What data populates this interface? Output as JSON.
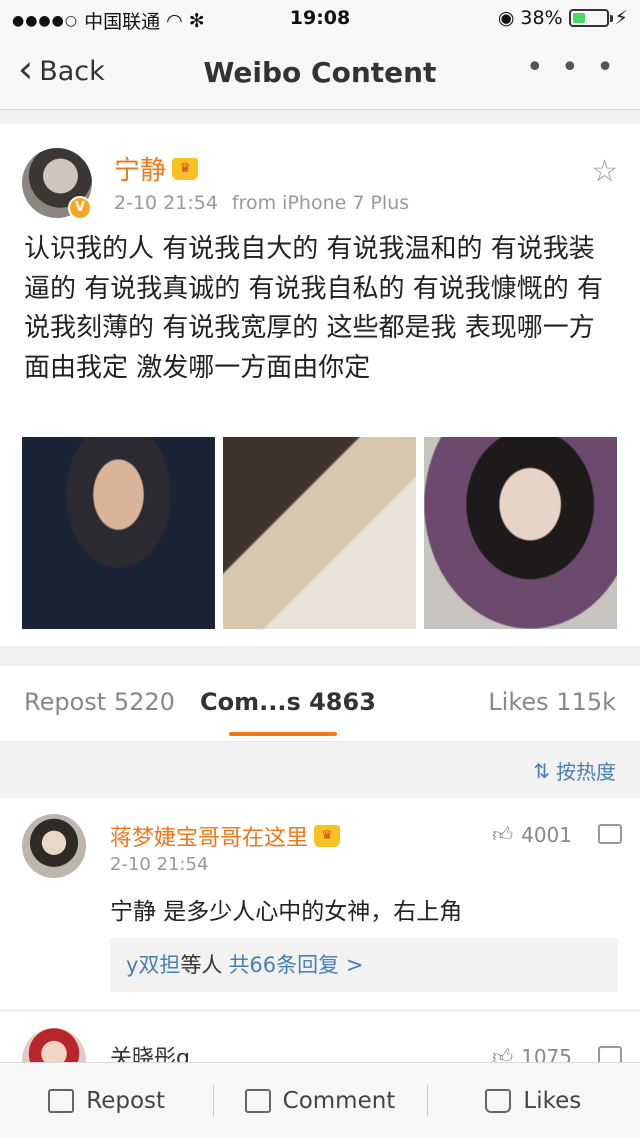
{
  "status_bar": {
    "carrier": "中国联通",
    "time": "19:08",
    "battery": "38%",
    "battery_level": 0.38
  },
  "nav": {
    "back_label": "Back",
    "title": "Weibo Content",
    "more_label": "• • •"
  },
  "post": {
    "author": "宁静",
    "verified_badge": "V",
    "time": "2-10 21:54",
    "source": "from iPhone 7 Plus",
    "text": "认识我的人  有说我自大的  有说我温和的  有说我装逼的  有说我真诚的  有说我自私的  有说我慷慨的  有说我刻薄的  有说我宽厚的  这些都是我  表现哪一方面由我定  激发哪一方面由你定",
    "photos": [
      "photo-1",
      "photo-2",
      "photo-3"
    ]
  },
  "tabs": {
    "repost": "Repost 5220",
    "comments": "Com...s 4863",
    "likes": "Likes 115k",
    "active": "comments"
  },
  "sort": {
    "label": "按热度"
  },
  "comments": [
    {
      "name": "蒋梦婕宝哥哥在这里",
      "time": "2-10 21:54",
      "text": "宁静 是多少人心中的女神，右上角",
      "likes": "4001",
      "replies_who": "y双担",
      "replies_mid": "等人",
      "replies_total": "共66条回复 >"
    },
    {
      "name": "关晓彤g",
      "likes": "1075"
    }
  ],
  "toolbar": {
    "repost": "Repost",
    "comment": "Comment",
    "likes": "Likes"
  },
  "colors": {
    "accent": "#f07818",
    "link": "#4a7fb5",
    "battery": "#4cd964"
  }
}
